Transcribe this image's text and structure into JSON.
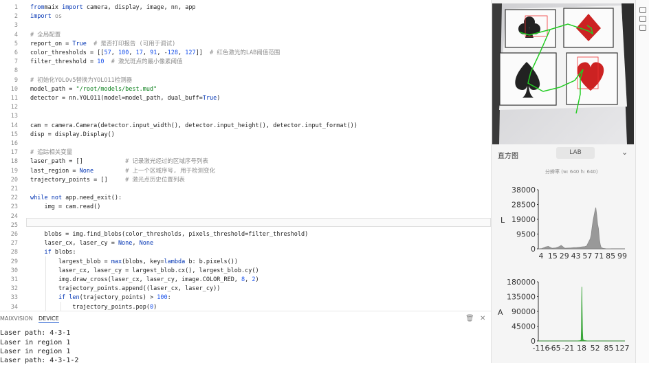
{
  "editor": {
    "lines": [
      {
        "n": "1",
        "t": [
          [
            "kw",
            "from"
          ],
          [
            "",
            "maix"
          ],
          [
            "kw",
            " import"
          ],
          [
            "",
            " camera, display, image, nn, app"
          ]
        ]
      },
      {
        "n": "2",
        "t": [
          [
            "kw",
            "import"
          ],
          [
            "",
            " "
          ],
          [
            "cm",
            "os"
          ]
        ]
      },
      {
        "n": "3",
        "t": []
      },
      {
        "n": "4",
        "t": [
          [
            "cm",
            "# 全局配置"
          ]
        ]
      },
      {
        "n": "5",
        "t": [
          [
            "",
            "report_on = "
          ],
          [
            "kw",
            "True"
          ],
          [
            "",
            " "
          ],
          [
            "cm",
            " # 是否打印报告 (可用于调试)"
          ]
        ]
      },
      {
        "n": "6",
        "t": [
          [
            "",
            "color_thresholds = [["
          ],
          [
            "num",
            "57"
          ],
          [
            ", ",
            ""
          ],
          [
            "num",
            "100"
          ],
          [
            "",
            ", "
          ],
          [
            "num",
            "17"
          ],
          [
            "",
            ", "
          ],
          [
            "num",
            "91"
          ],
          [
            "",
            ", -"
          ],
          [
            "num",
            "128"
          ],
          [
            "",
            ", "
          ],
          [
            "num",
            "127"
          ],
          [
            "",
            "]]  "
          ],
          [
            "cm",
            "# 红色激光的LAB阈值范围"
          ]
        ]
      },
      {
        "n": "7",
        "t": [
          [
            "",
            "filter_threshold = "
          ],
          [
            "num",
            "10"
          ],
          [
            "",
            " "
          ],
          [
            "cm",
            " # 激光斑点的最小像素阈值"
          ]
        ]
      },
      {
        "n": "8",
        "t": []
      },
      {
        "n": "9",
        "t": [
          [
            "cm",
            "# 初始化YOLOv5替换为YOLO11检测器"
          ]
        ]
      },
      {
        "n": "10",
        "t": [
          [
            "",
            "model_path = "
          ],
          [
            "str",
            "\"/root/models/best.mud\""
          ]
        ]
      },
      {
        "n": "11",
        "t": [
          [
            "",
            "detector = nn.YOLO11(model=model_path, dual_buff="
          ],
          [
            "kw",
            "True"
          ],
          [
            "",
            ")"
          ]
        ]
      },
      {
        "n": "12",
        "t": []
      },
      {
        "n": "13",
        "t": []
      },
      {
        "n": "14",
        "t": [
          [
            "",
            "cam = camera.Camera(detector.input_width(), detector.input_height(), detector.input_format())"
          ]
        ]
      },
      {
        "n": "15",
        "t": [
          [
            "",
            "disp = display.Display()"
          ]
        ]
      },
      {
        "n": "16",
        "t": []
      },
      {
        "n": "17",
        "t": [
          [
            "cm",
            "# 追踪相关变量"
          ]
        ]
      },
      {
        "n": "18",
        "t": [
          [
            "",
            "laser_path = []            "
          ],
          [
            "cm",
            "# 记录激光经过的区域序号列表"
          ]
        ]
      },
      {
        "n": "19",
        "t": [
          [
            "",
            "last_region = "
          ],
          [
            "kw",
            "None"
          ],
          [
            "",
            "         "
          ],
          [
            "cm",
            "# 上一个区域序号, 用于检测变化"
          ]
        ]
      },
      {
        "n": "20",
        "t": [
          [
            "",
            "trajectory_points = []     "
          ],
          [
            "cm",
            "# 激光点历史位置列表"
          ]
        ]
      },
      {
        "n": "21",
        "t": []
      },
      {
        "n": "22",
        "t": [
          [
            "kw",
            "while not"
          ],
          [
            "",
            " app.need_exit():"
          ]
        ]
      },
      {
        "n": "23",
        "t": [
          [
            "",
            "    img = cam.read()"
          ]
        ]
      },
      {
        "n": "24",
        "t": []
      },
      {
        "n": "25",
        "t": []
      },
      {
        "n": "26",
        "t": [
          [
            "",
            "    blobs = img.find_blobs(color_thresholds, pixels_threshold=filter_threshold)"
          ]
        ]
      },
      {
        "n": "27",
        "t": [
          [
            "",
            "    laser_cx, laser_cy = "
          ],
          [
            "kw",
            "None"
          ],
          [
            "",
            ", "
          ],
          [
            "kw",
            "None"
          ]
        ]
      },
      {
        "n": "28",
        "t": [
          [
            "kw",
            "    if"
          ],
          [
            "",
            " blobs:"
          ]
        ]
      },
      {
        "n": "29",
        "t": [
          [
            "",
            "        largest_blob = "
          ],
          [
            "kw",
            "max"
          ],
          [
            "",
            "(blobs, key="
          ],
          [
            "kw",
            "lambda"
          ],
          [
            "",
            " b: b.pixels())"
          ]
        ]
      },
      {
        "n": "30",
        "t": [
          [
            "",
            "        laser_cx, laser_cy = largest_blob.cx(), largest_blob.cy()"
          ]
        ]
      },
      {
        "n": "31",
        "t": [
          [
            "",
            "        img.draw_cross(laser_cx, laser_cy, image.COLOR_RED, "
          ],
          [
            "num",
            "8"
          ],
          [
            "",
            ", "
          ],
          [
            "num",
            "2"
          ],
          [
            "",
            ")"
          ]
        ]
      },
      {
        "n": "32",
        "t": [
          [
            "",
            "        trajectory_points.append((laser_cx, laser_cy))"
          ]
        ]
      },
      {
        "n": "33",
        "t": [
          [
            "kw",
            "        if"
          ],
          [
            "",
            " "
          ],
          [
            "kw",
            "len"
          ],
          [
            "",
            "(trajectory_points) > "
          ],
          [
            "num",
            "100"
          ],
          [
            "",
            ":"
          ]
        ]
      },
      {
        "n": "34",
        "t": [
          [
            "",
            "            trajectory_points.pop("
          ],
          [
            "num",
            "0"
          ],
          [
            "",
            ")"
          ]
        ]
      }
    ]
  },
  "panel": {
    "tabs": [
      "MAIXVISION",
      "DEVICE"
    ],
    "output": [
      "Laser path: 4-3-1",
      "Laser in region 1",
      "Laser in region 1",
      "Laser path: 4-3-1-2"
    ]
  },
  "histogram": {
    "title": "直方图",
    "mode": "LAB",
    "resolution": "分辨率 (w: 640 h: 640)"
  },
  "chart_data": [
    {
      "type": "area",
      "ylabel": "L",
      "ylim": [
        0,
        38000
      ],
      "yticks": [
        "38000",
        "28500",
        "19000",
        "9500",
        "0"
      ],
      "xticks": [
        "4",
        "15",
        "29",
        "43",
        "57",
        "71",
        "85",
        "99"
      ],
      "color": "#888888",
      "x": [
        4,
        8,
        12,
        15,
        19,
        23,
        27,
        29,
        33,
        36,
        40,
        43,
        46,
        49,
        52,
        55,
        57,
        59,
        61,
        62,
        63,
        64,
        65,
        66,
        67,
        68,
        69,
        70,
        71,
        72,
        73,
        75,
        78,
        82,
        85,
        90,
        95,
        99
      ],
      "values": [
        0,
        200,
        1200,
        1600,
        400,
        600,
        1400,
        2200,
        400,
        500,
        600,
        800,
        900,
        1000,
        1300,
        1400,
        1800,
        4200,
        6500,
        9000,
        14000,
        18000,
        21000,
        24000,
        26500,
        22000,
        16000,
        13000,
        6000,
        2500,
        800,
        300,
        100,
        50,
        0,
        0,
        0,
        0
      ]
    },
    {
      "type": "area",
      "ylabel": "A",
      "ylim": [
        0,
        180000
      ],
      "yticks": [
        "180000",
        "135000",
        "90000",
        "45000",
        "0"
      ],
      "xticks": [
        "-116",
        "-65",
        "-21",
        "18",
        "52",
        "85",
        "127"
      ],
      "color": "#2ca02c",
      "x": [
        -116,
        -80,
        -40,
        -10,
        0,
        4,
        5,
        6,
        7,
        8,
        9,
        10,
        14,
        20,
        30,
        50,
        85,
        127
      ],
      "values": [
        0,
        0,
        0,
        100,
        600,
        2000,
        40000,
        165000,
        90000,
        30000,
        8000,
        3000,
        1200,
        500,
        200,
        0,
        0,
        0
      ]
    }
  ]
}
